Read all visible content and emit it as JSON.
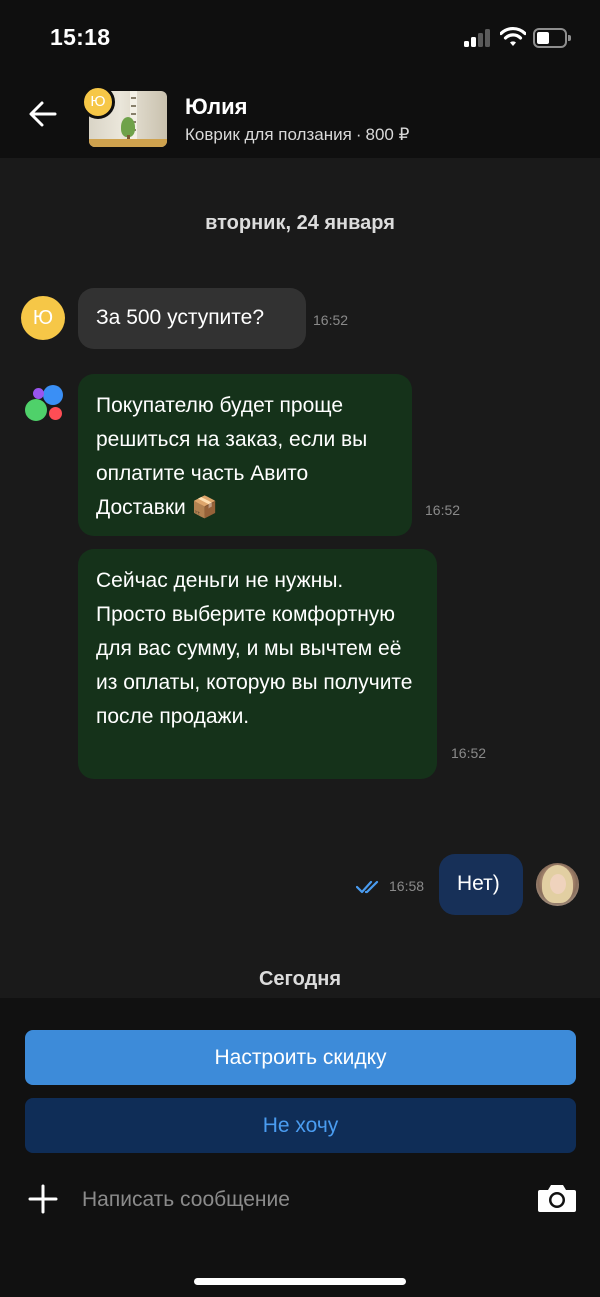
{
  "status_bar": {
    "time": "15:18",
    "battery_level": 0.3
  },
  "header": {
    "contact_name": "Юлия",
    "seller_initial": "Ю",
    "listing_title": "Коврик для ползания",
    "listing_separator": "·",
    "listing_price": "800 ₽",
    "icons": {
      "back": "arrow-left-icon"
    }
  },
  "chat": {
    "date_separator": "вторник, 24 января",
    "messages": [
      {
        "from": "contact",
        "avatar_initial": "Ю",
        "text": "За 500 уступите?",
        "time": "16:52"
      },
      {
        "from": "avito",
        "text": "Покупателю будет проще решиться на заказ, если вы оплатите часть Авито Доставки 📦",
        "time": "16:52"
      },
      {
        "from": "avito",
        "text": "Сейчас деньги не нужны. Просто выберите комфортную для вас сумму, и мы вычтем её из оплаты, которую вы получите после продажи.",
        "time": "16:52"
      },
      {
        "from": "me",
        "text": "Нет)",
        "time": "16:58",
        "status": "read"
      }
    ],
    "today_separator": "Сегодня"
  },
  "actions": {
    "primary_label": "Настроить скидку",
    "secondary_label": "Не хочу"
  },
  "composer": {
    "placeholder": "Написать сообщение",
    "icons": {
      "attach": "plus-icon",
      "camera": "camera-icon"
    }
  },
  "colors": {
    "background": "#1a1a1a",
    "incoming_bubble": "#323232",
    "avito_bubble": "#15321a",
    "outgoing_bubble": "#173058",
    "primary_button": "#3d8bd9",
    "secondary_button": "#0f2d57",
    "secondary_text": "#4a9cf0",
    "avatar_yellow": "#f6c747"
  }
}
